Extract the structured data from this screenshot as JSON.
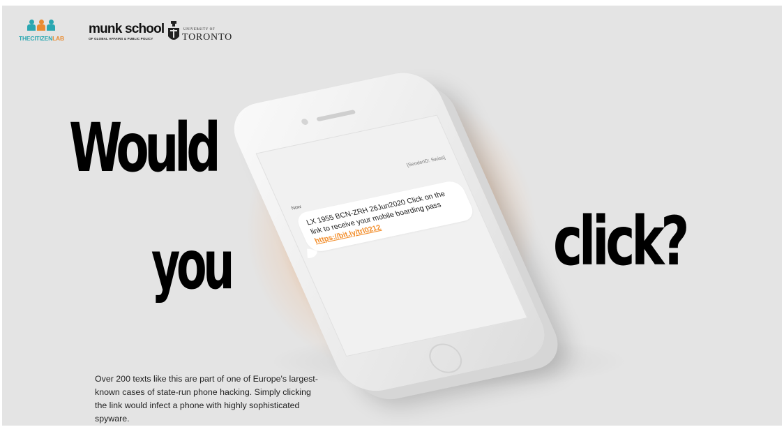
{
  "header": {
    "citizen_lab": {
      "part1": "THECITIZEN",
      "part2": "LAB",
      "color_teal": "#2aa7b1",
      "color_orange": "#e98b32"
    },
    "munk_school": {
      "title": "munk school",
      "subtitle": "OF GLOBAL AFFAIRS & PUBLIC POLICY"
    },
    "university": {
      "small": "UNIVERSITY OF",
      "big": "TORONTO"
    }
  },
  "headline": {
    "word1": "Would",
    "word2": "you",
    "word3": "click?"
  },
  "phone": {
    "sender": "[SenderID: Swiss]",
    "timestamp": "Now",
    "message_line": "LX 1955 BCN-ZRH 26Jun2020 Click on the link to receive your mobile boarding pass",
    "message_link": "https://bit.ly/trl0212"
  },
  "caption": "Over 200 texts like this are part of one of Europe's largest-known cases of state-run phone hacking. Simply clicking the link would infect a phone with highly sophisticated spyware.",
  "colors": {
    "background": "#e4e4e4",
    "accent": "#f28c28",
    "text": "#000000"
  }
}
